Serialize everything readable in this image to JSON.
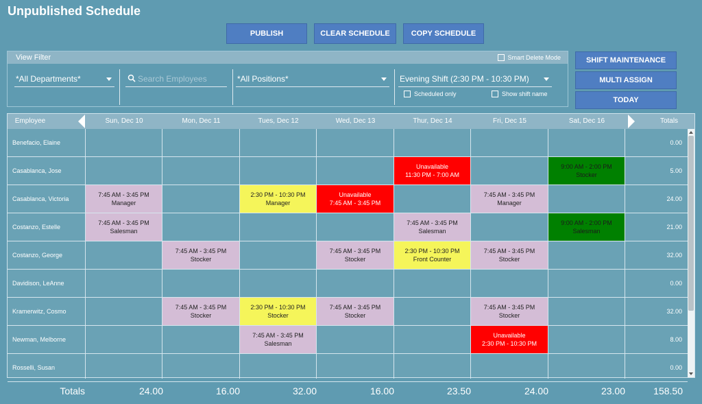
{
  "page": {
    "title": "Unpublished Schedule"
  },
  "toolbar": {
    "publish": "PUBLISH",
    "clear": "CLEAR SCHEDULE",
    "copy": "COPY SCHEDULE"
  },
  "filter": {
    "heading": "View Filter",
    "smart_delete": "Smart Delete Mode",
    "department": "*All Departments*",
    "search_placeholder": "Search Employees",
    "position": "*All Positions*",
    "shift": "Evening Shift (2:30 PM - 10:30 PM)",
    "scheduled_only": "Scheduled only",
    "show_shift_name": "Show shift name"
  },
  "side_buttons": {
    "shift_maintenance": "SHIFT MAINTENANCE",
    "multi_assign": "MULTI ASSIGN",
    "today": "TODAY"
  },
  "colors": {
    "normal": "#d4bdd6",
    "evening": "#f5f55a",
    "unavailable": "#ff0000",
    "special": "#008000"
  },
  "grid": {
    "employee_header": "Employee",
    "totals_header": "Totals",
    "days": [
      "Sun, Dec 10",
      "Mon, Dec 11",
      "Tues, Dec 12",
      "Wed, Dec 13",
      "Thur, Dec 14",
      "Fri, Dec 15",
      "Sat, Dec 16"
    ],
    "rows": [
      {
        "name": "Benefacio, Elaine",
        "total": "0.00"
      },
      {
        "name": "Casablanca, Jose",
        "total": "5.00"
      },
      {
        "name": "Casablanca, Victoria",
        "total": "24.00"
      },
      {
        "name": "Costanzo, Estelle",
        "total": "21.00"
      },
      {
        "name": "Costanzo, George",
        "total": "32.00"
      },
      {
        "name": "Davidison, LeAnne",
        "total": "0.00"
      },
      {
        "name": "Kramerwitz, Cosmo",
        "total": "32.00"
      },
      {
        "name": "Newman, Melborne",
        "total": "8.00"
      },
      {
        "name": "Rosselli, Susan",
        "total": "0.00"
      }
    ],
    "shifts": [
      {
        "row": 1,
        "day": 4,
        "line1": "Unavailable",
        "line2": "11:30 PM - 7:00 AM",
        "kind": "unavailable"
      },
      {
        "row": 1,
        "day": 6,
        "line1": "9:00 AM - 2:00 PM",
        "line2": "Stocker",
        "kind": "special"
      },
      {
        "row": 2,
        "day": 0,
        "line1": "7:45 AM - 3:45 PM",
        "line2": "Manager",
        "kind": "normal"
      },
      {
        "row": 2,
        "day": 2,
        "line1": "2:30 PM - 10:30 PM",
        "line2": "Manager",
        "kind": "evening"
      },
      {
        "row": 2,
        "day": 3,
        "line1": "Unavailable",
        "line2": "7:45 AM - 3:45 PM",
        "kind": "unavailable"
      },
      {
        "row": 2,
        "day": 5,
        "line1": "7:45 AM - 3:45 PM",
        "line2": "Manager",
        "kind": "normal"
      },
      {
        "row": 3,
        "day": 0,
        "line1": "7:45 AM - 3:45 PM",
        "line2": "Salesman",
        "kind": "normal"
      },
      {
        "row": 3,
        "day": 4,
        "line1": "7:45 AM - 3:45 PM",
        "line2": "Salesman",
        "kind": "normal"
      },
      {
        "row": 3,
        "day": 6,
        "line1": "9:00 AM - 2:00 PM",
        "line2": "Salesman",
        "kind": "special"
      },
      {
        "row": 4,
        "day": 1,
        "line1": "7:45 AM - 3:45 PM",
        "line2": "Stocker",
        "kind": "normal"
      },
      {
        "row": 4,
        "day": 3,
        "line1": "7:45 AM - 3:45 PM",
        "line2": "Stocker",
        "kind": "normal"
      },
      {
        "row": 4,
        "day": 4,
        "line1": "2:30 PM - 10:30 PM",
        "line2": "Front Counter",
        "kind": "evening"
      },
      {
        "row": 4,
        "day": 5,
        "line1": "7:45 AM - 3:45 PM",
        "line2": "Stocker",
        "kind": "normal"
      },
      {
        "row": 6,
        "day": 1,
        "line1": "7:45 AM - 3:45 PM",
        "line2": "Stocker",
        "kind": "normal"
      },
      {
        "row": 6,
        "day": 2,
        "line1": "2:30 PM - 10:30 PM",
        "line2": "Stocker",
        "kind": "evening"
      },
      {
        "row": 6,
        "day": 3,
        "line1": "7:45 AM - 3:45 PM",
        "line2": "Stocker",
        "kind": "normal"
      },
      {
        "row": 6,
        "day": 5,
        "line1": "7:45 AM - 3:45 PM",
        "line2": "Stocker",
        "kind": "normal"
      },
      {
        "row": 7,
        "day": 2,
        "line1": "7:45 AM - 3:45 PM",
        "line2": "Salesman",
        "kind": "normal"
      },
      {
        "row": 7,
        "day": 5,
        "line1": "Unavailable",
        "line2": "2:30 PM - 10:30 PM",
        "kind": "unavailable"
      }
    ]
  },
  "footer": {
    "label": "Totals",
    "day_totals": [
      "24.00",
      "16.00",
      "32.00",
      "16.00",
      "23.50",
      "24.00",
      "23.00"
    ],
    "grand_total": "158.50"
  }
}
